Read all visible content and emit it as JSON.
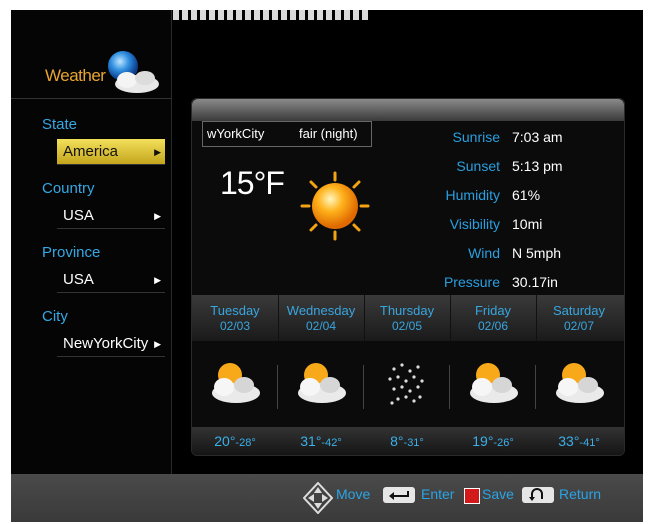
{
  "sidebar": {
    "logo_text": "Weather",
    "sections": [
      {
        "label": "State",
        "value": "America",
        "selected": true
      },
      {
        "label": "Country",
        "value": "USA",
        "selected": false
      },
      {
        "label": "Province",
        "value": "USA",
        "selected": false
      },
      {
        "label": "City",
        "value": "NewYorkCity",
        "selected": false
      }
    ]
  },
  "current": {
    "city": "wYorkCity",
    "condition": "fair (night)",
    "temperature": "15°F",
    "icon": "sun-icon"
  },
  "details": [
    {
      "key": "Sunrise",
      "value": "7:03 am"
    },
    {
      "key": "Sunset",
      "value": "5:13 pm"
    },
    {
      "key": "Humidity",
      "value": "61%"
    },
    {
      "key": "Visibility",
      "value": "10mi"
    },
    {
      "key": "Wind",
      "value": "N 5mph"
    },
    {
      "key": "Pressure",
      "value": "30.17in"
    }
  ],
  "forecast": [
    {
      "day": "Tuesday",
      "date": "02/03",
      "icon": "partly-cloudy-icon",
      "high": "20°",
      "low": "-28°"
    },
    {
      "day": "Wednesday",
      "date": "02/04",
      "icon": "partly-cloudy-icon",
      "high": "31°",
      "low": "-42°"
    },
    {
      "day": "Thursday",
      "date": "02/05",
      "icon": "snow-icon",
      "high": "8°",
      "low": "-31°"
    },
    {
      "day": "Friday",
      "date": "02/06",
      "icon": "partly-cloudy-icon",
      "high": "19°",
      "low": "-26°"
    },
    {
      "day": "Saturday",
      "date": "02/07",
      "icon": "partly-cloudy-icon",
      "high": "33°",
      "low": "-41°"
    }
  ],
  "footer": {
    "move_label": "Move",
    "enter_label": "Enter",
    "save_label": "Save",
    "return_label": "Return"
  },
  "colors": {
    "accent_blue": "#2aa4e6",
    "selection_yellow": "#e0c93a",
    "logo_orange": "#e8a531",
    "save_red": "#d21a1a"
  }
}
